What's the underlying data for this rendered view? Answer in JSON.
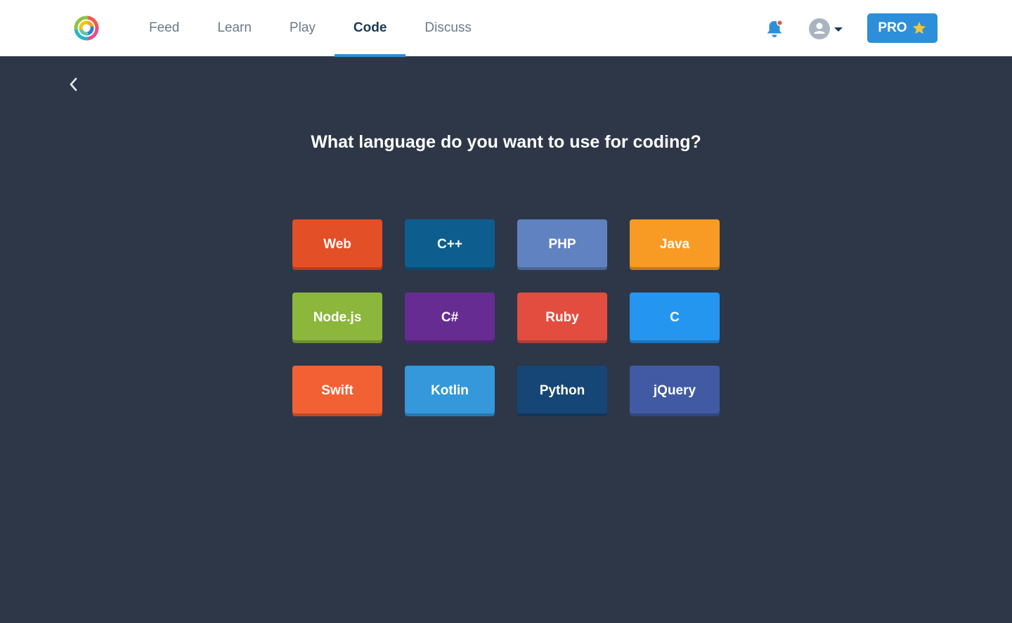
{
  "nav": {
    "items": [
      {
        "label": "Feed",
        "active": false
      },
      {
        "label": "Learn",
        "active": false
      },
      {
        "label": "Play",
        "active": false
      },
      {
        "label": "Code",
        "active": true
      },
      {
        "label": "Discuss",
        "active": false
      }
    ]
  },
  "header": {
    "pro_label": "PRO",
    "brand_color": "#2d8fd9",
    "notification_dot_color": "#e8533a"
  },
  "main": {
    "heading": "What language do you want to use for coding?",
    "languages": [
      {
        "label": "Web",
        "color": "#e34f26"
      },
      {
        "label": "C++",
        "color": "#0d5e8f"
      },
      {
        "label": "PHP",
        "color": "#6182c0"
      },
      {
        "label": "Java",
        "color": "#f89b25"
      },
      {
        "label": "Node.js",
        "color": "#8cb73c"
      },
      {
        "label": "C#",
        "color": "#672c91"
      },
      {
        "label": "Ruby",
        "color": "#e34d40"
      },
      {
        "label": "C",
        "color": "#2496f0"
      },
      {
        "label": "Swift",
        "color": "#f26133"
      },
      {
        "label": "Kotlin",
        "color": "#3498db"
      },
      {
        "label": "Python",
        "color": "#164675"
      },
      {
        "label": "jQuery",
        "color": "#415aa3"
      }
    ]
  },
  "icons": {
    "logo": "sololearn-logo-icon",
    "bell": "bell-icon",
    "avatar": "user-avatar-icon",
    "caret": "caret-down-icon",
    "star": "star-icon",
    "back": "chevron-left-icon"
  }
}
